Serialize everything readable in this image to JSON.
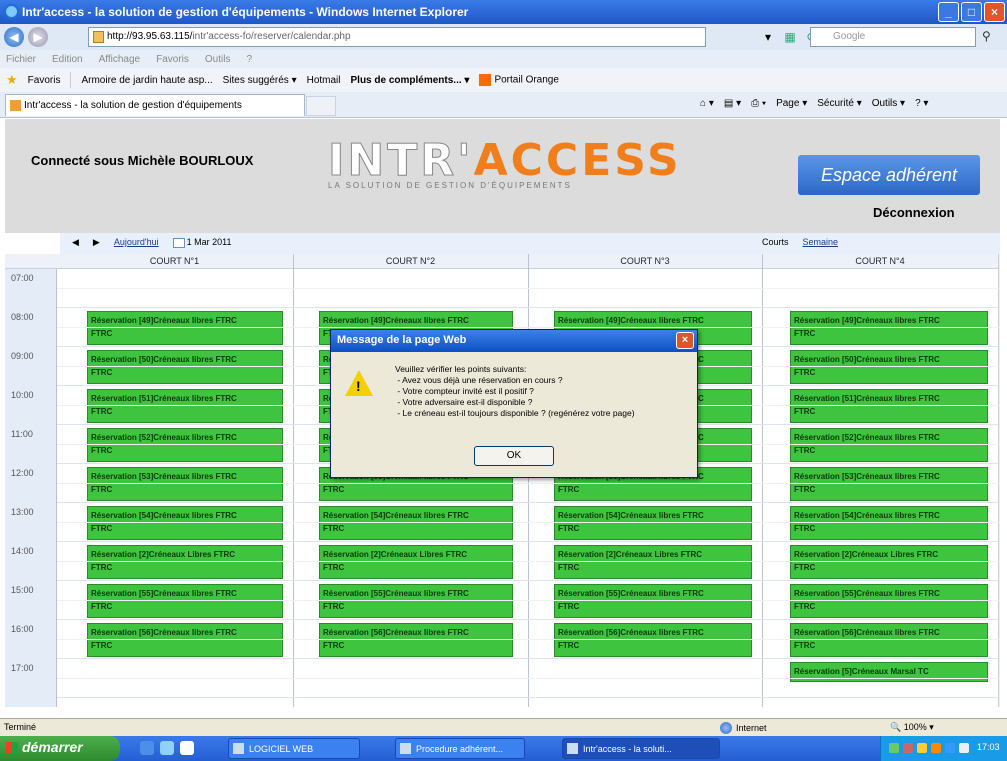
{
  "window": {
    "title": "Intr'access - la solution de gestion d'équipements - Windows Internet Explorer"
  },
  "address": {
    "url_domain": "http://93.95.63.115/",
    "url_rest": "intr'access-fo/reserver/calendar.php",
    "search_placeholder": "Google"
  },
  "menu": [
    "Fichier",
    "Edition",
    "Affichage",
    "Favoris",
    "Outils",
    "?"
  ],
  "favorites": {
    "label": "Favoris",
    "items": [
      "Armoire de jardin haute asp...",
      "Sites suggérés ▾",
      "Hotmail",
      "Plus de compléments... ▾",
      "Portail Orange"
    ]
  },
  "tab": {
    "label": "Intr'access - la solution de gestion d'équipements"
  },
  "commandbar": [
    "Page ▾",
    "Sécurité ▾",
    "Outils ▾"
  ],
  "header": {
    "connected": "Connecté sous Michèle BOURLOUX",
    "logo_word_a": "INTR'",
    "logo_word_b": "ACCESS",
    "logo_tagline": "LA SOLUTION DE GESTION D'ÉQUIPEMENTS",
    "espace": "Espace adhérent",
    "deconnexion": "Déconnexion"
  },
  "calendar": {
    "today": "Aujourd'hui",
    "date": "1 Mar 2011",
    "view_courts": "Courts",
    "view_semaine": "Semaine",
    "columns": [
      "COURT N°1",
      "COURT N°2",
      "COURT N°3",
      "COURT N°4"
    ],
    "times": [
      "07:00",
      "08:00",
      "09:00",
      "10:00",
      "11:00",
      "12:00",
      "13:00",
      "14:00",
      "15:00",
      "16:00",
      "17:00"
    ],
    "events": [
      {
        "line1": "Réservation [49]Créneaux libres FTRC",
        "line2": "FTRC"
      },
      {
        "line1": "Réservation [50]Créneaux libres FTRC",
        "line2": "FTRC"
      },
      {
        "line1": "Réservation [51]Créneaux libres FTRC",
        "line2": "FTRC"
      },
      {
        "line1": "Réservation [52]Créneaux libres FTRC",
        "line2": "FTRC"
      },
      {
        "line1": "Réservation [53]Créneaux libres FTRC",
        "line2": "FTRC"
      },
      {
        "line1": "Réservation [54]Créneaux libres FTRC",
        "line2": "FTRC"
      },
      {
        "line1": "Réservation [2]Créneaux Libres FTRC",
        "line2": "FTRC"
      },
      {
        "line1": "Réservation [55]Créneaux libres FTRC",
        "line2": "FTRC"
      },
      {
        "line1": "Réservation [56]Créneaux libres FTRC",
        "line2": "FTRC"
      }
    ],
    "extra_event": "Réservation [5]Créneaux Marsal TC"
  },
  "dialog": {
    "title": "Message de la page Web",
    "message": "Veuillez vérifier les points suivants:\n - Avez vous déjà une réservation en cours ?\n - Votre compteur invité est il positif ?\n - Votre adversaire est-il disponible ?\n - Le créneau est-il toujours disponible ? (regénérez votre page)",
    "ok": "OK"
  },
  "status": {
    "left": "Terminé",
    "zone": "Internet",
    "zoom": "100%"
  },
  "taskbar": {
    "start": "démarrer",
    "buttons": [
      "LOGICIEL WEB",
      "Procedure adhérent...",
      "Intr'access - la soluti..."
    ],
    "clock": "17:03"
  }
}
